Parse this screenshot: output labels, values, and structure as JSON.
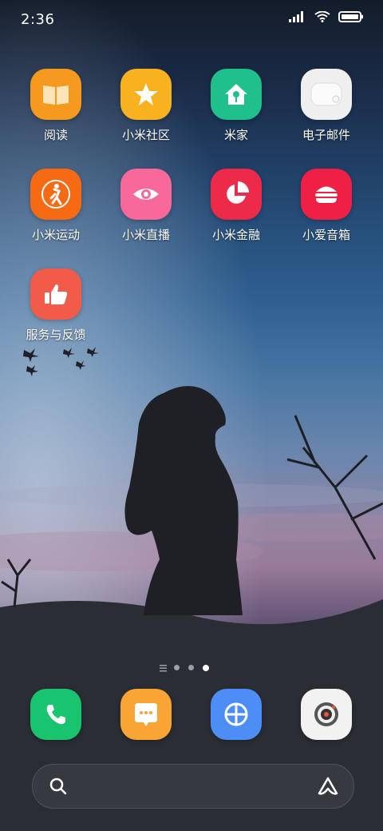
{
  "status": {
    "time": "2:36"
  },
  "apps": [
    {
      "label": "阅读",
      "icon": "book-icon",
      "color": "#f59a1e"
    },
    {
      "label": "小米社区",
      "icon": "star-icon",
      "color": "#f9b21f"
    },
    {
      "label": "米家",
      "icon": "home-key-icon",
      "color": "#1fc08c"
    },
    {
      "label": "电子邮件",
      "icon": "mail-icon",
      "color": "#f1f1f1"
    },
    {
      "label": "小米运动",
      "icon": "runner-icon",
      "color": "#f56a13"
    },
    {
      "label": "小米直播",
      "icon": "eye-icon",
      "color": "#f7699b"
    },
    {
      "label": "小米金融",
      "icon": "pie-icon",
      "color": "#ee2a4b"
    },
    {
      "label": "小爱音箱",
      "icon": "burger-icon",
      "color": "#ef1f45"
    },
    {
      "label": "服务与反馈",
      "icon": "thumbs-up-icon",
      "color": "#f15b4a"
    }
  ],
  "dock": [
    {
      "icon": "phone-icon",
      "color": "#18c46e"
    },
    {
      "icon": "message-icon",
      "color": "#f8a536"
    },
    {
      "icon": "browser-icon",
      "color": "#4c8ef6"
    },
    {
      "icon": "camera-icon",
      "color": "#f2f2f2"
    }
  ],
  "pager": {
    "pages": 3,
    "current": 3
  }
}
